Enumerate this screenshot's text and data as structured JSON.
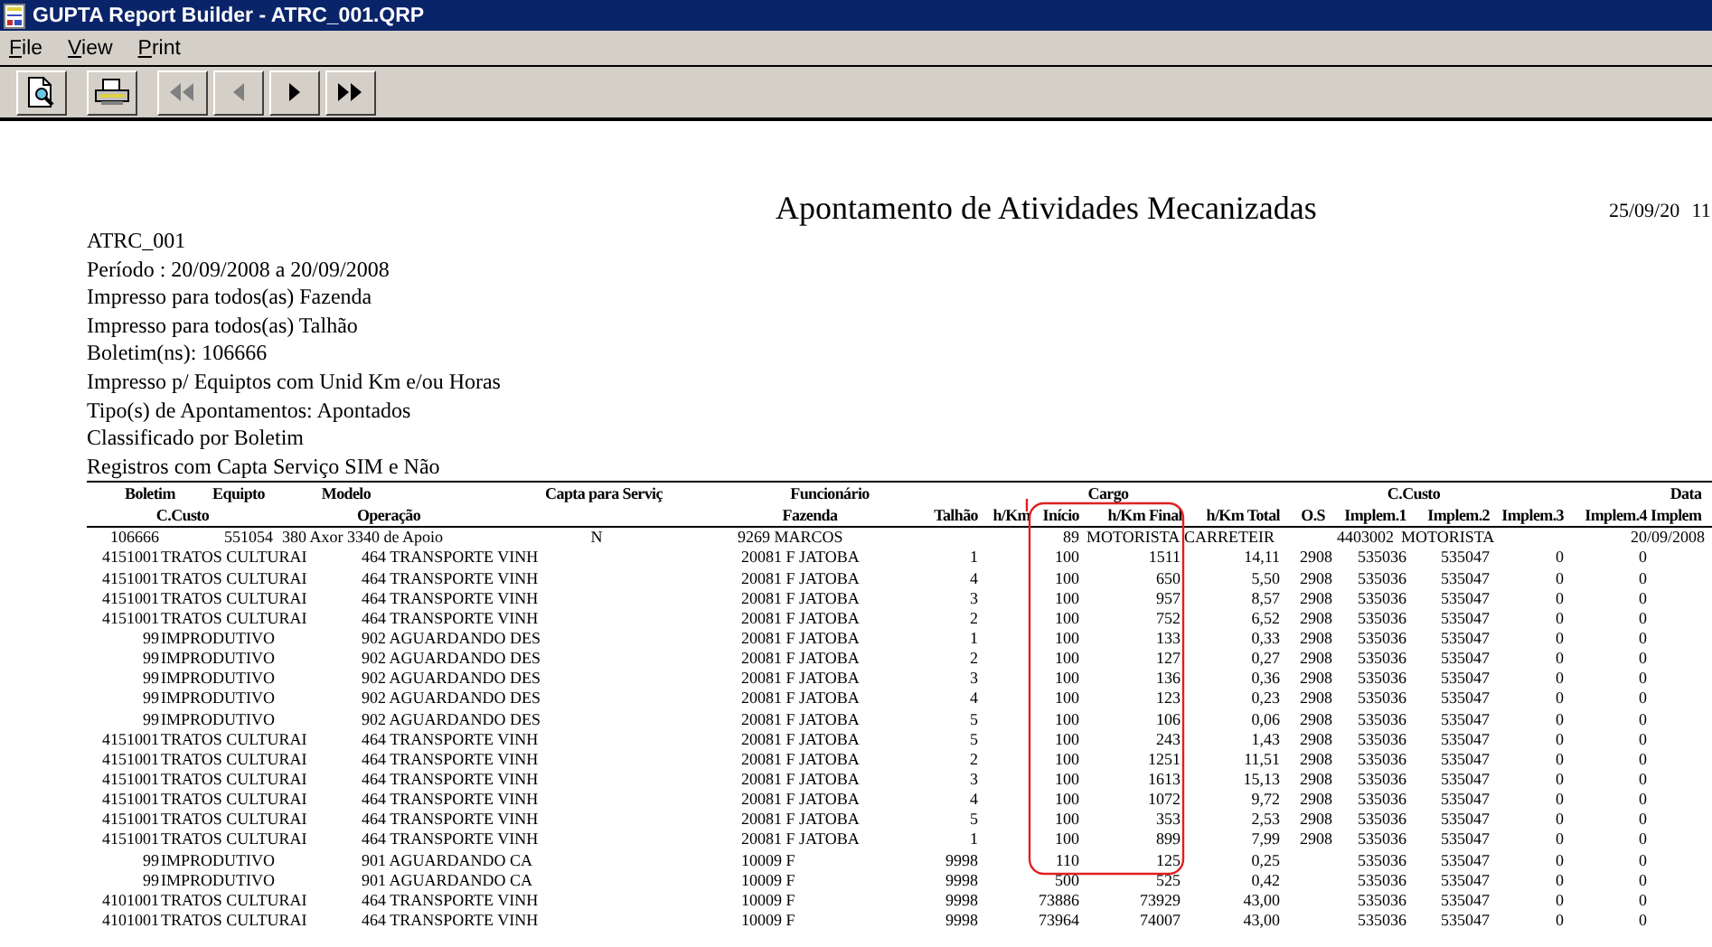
{
  "window": {
    "title": "GUPTA Report Builder - ATRC_001.QRP"
  },
  "menu": [
    {
      "label": "File"
    },
    {
      "label": "View"
    },
    {
      "label": "Print"
    }
  ],
  "toolbar": [
    {
      "kind": "preview",
      "disabled": false
    },
    {
      "kind": "print",
      "disabled": false
    },
    {
      "kind": "first",
      "disabled": true
    },
    {
      "kind": "previous",
      "disabled": true
    },
    {
      "kind": "next",
      "disabled": false
    },
    {
      "kind": "last",
      "disabled": false
    }
  ],
  "report": {
    "title": "Apontamento de Atividades Mecanizadas",
    "date": "25/09/20",
    "time": "11",
    "info": [
      "ATRC_001",
      "Período : 20/09/2008 a 20/09/2008",
      "Impresso para todos(as) Fazenda",
      "Impresso para todos(as) Talhão",
      "Boletim(ns): 106666",
      "Impresso p/ Equiptos com Unid Km e/ou Horas",
      "Tipo(s) de Apontamentos: Apontados",
      "Classificado por Boletim",
      "Registros com Capta Serviço SIM e Não"
    ],
    "table": {
      "header_1": [
        "Boletim",
        "Equipto",
        "Modelo",
        "Capta para Serviç",
        "Funcionário",
        "Cargo",
        "C.Custo",
        "Data"
      ],
      "header_2": [
        "C.Custo",
        "Operação",
        "Fazenda",
        "Talhão",
        "h/Km",
        "Início",
        "h/Km Final",
        "h/Km Total",
        "O.S",
        "Implem.1",
        "Implem.2",
        "Implem.3",
        "Implem.4",
        "Implem"
      ],
      "group": {
        "boletim": "106666",
        "equipto": "551054",
        "modelo": "380 Axor 3340 de Apoio",
        "capta": "N",
        "funcionario": "9269 MARCOS",
        "cargo_code": "89",
        "cargo": "MOTORISTA",
        "column_8": "CARRETEIR",
        "c_custo_code": "4403002",
        "c_custo": "MOTORISTA",
        "data": "20/09/2008"
      },
      "rows": [
        {
          "c_custo": "4151001",
          "c_custo_name": "TRATOS CULTURAI",
          "operacao": "464 TRANSPORTE VINH",
          "fazenda": "20081 F JATOBA",
          "talhao": "1",
          "inicio": "100",
          "final": "1511",
          "total": "14,11",
          "os": "2908",
          "implem_1": "535036",
          "implem_2": "535047",
          "implem_3": "0",
          "implem_4": "0"
        },
        {
          "c_custo": "4151001",
          "c_custo_name": "TRATOS CULTURAI",
          "operacao": "464 TRANSPORTE VINH",
          "fazenda": "20081 F JATOBA",
          "talhao": "4",
          "inicio": "100",
          "final": "650",
          "total": "5,50",
          "os": "2908",
          "implem_1": "535036",
          "implem_2": "535047",
          "implem_3": "0",
          "implem_4": "0"
        },
        {
          "c_custo": "4151001",
          "c_custo_name": "TRATOS CULTURAI",
          "operacao": "464 TRANSPORTE VINH",
          "fazenda": "20081 F JATOBA",
          "talhao": "3",
          "inicio": "100",
          "final": "957",
          "total": "8,57",
          "os": "2908",
          "implem_1": "535036",
          "implem_2": "535047",
          "implem_3": "0",
          "implem_4": "0"
        },
        {
          "c_custo": "4151001",
          "c_custo_name": "TRATOS CULTURAI",
          "operacao": "464 TRANSPORTE VINH",
          "fazenda": "20081 F JATOBA",
          "talhao": "2",
          "inicio": "100",
          "final": "752",
          "total": "6,52",
          "os": "2908",
          "implem_1": "535036",
          "implem_2": "535047",
          "implem_3": "0",
          "implem_4": "0"
        },
        {
          "c_custo": "99",
          "c_custo_name": "IMPRODUTIVO",
          "operacao": "902 AGUARDANDO DES",
          "fazenda": "20081 F JATOBA",
          "talhao": "1",
          "inicio": "100",
          "final": "133",
          "total": "0,33",
          "os": "2908",
          "implem_1": "535036",
          "implem_2": "535047",
          "implem_3": "0",
          "implem_4": "0"
        },
        {
          "c_custo": "99",
          "c_custo_name": "IMPRODUTIVO",
          "operacao": "902 AGUARDANDO DES",
          "fazenda": "20081 F JATOBA",
          "talhao": "2",
          "inicio": "100",
          "final": "127",
          "total": "0,27",
          "os": "2908",
          "implem_1": "535036",
          "implem_2": "535047",
          "implem_3": "0",
          "implem_4": "0"
        },
        {
          "c_custo": "99",
          "c_custo_name": "IMPRODUTIVO",
          "operacao": "902 AGUARDANDO DES",
          "fazenda": "20081 F JATOBA",
          "talhao": "3",
          "inicio": "100",
          "final": "136",
          "total": "0,36",
          "os": "2908",
          "implem_1": "535036",
          "implem_2": "535047",
          "implem_3": "0",
          "implem_4": "0"
        },
        {
          "c_custo": "99",
          "c_custo_name": "IMPRODUTIVO",
          "operacao": "902 AGUARDANDO DES",
          "fazenda": "20081 F JATOBA",
          "talhao": "4",
          "inicio": "100",
          "final": "123",
          "total": "0,23",
          "os": "2908",
          "implem_1": "535036",
          "implem_2": "535047",
          "implem_3": "0",
          "implem_4": "0"
        },
        {
          "c_custo": "99",
          "c_custo_name": "IMPRODUTIVO",
          "operacao": "902 AGUARDANDO DES",
          "fazenda": "20081 F JATOBA",
          "talhao": "5",
          "inicio": "100",
          "final": "106",
          "total": "0,06",
          "os": "2908",
          "implem_1": "535036",
          "implem_2": "535047",
          "implem_3": "0",
          "implem_4": "0"
        },
        {
          "c_custo": "4151001",
          "c_custo_name": "TRATOS CULTURAI",
          "operacao": "464 TRANSPORTE VINH",
          "fazenda": "20081 F JATOBA",
          "talhao": "5",
          "inicio": "100",
          "final": "243",
          "total": "1,43",
          "os": "2908",
          "implem_1": "535036",
          "implem_2": "535047",
          "implem_3": "0",
          "implem_4": "0"
        },
        {
          "c_custo": "4151001",
          "c_custo_name": "TRATOS CULTURAI",
          "operacao": "464 TRANSPORTE VINH",
          "fazenda": "20081 F JATOBA",
          "talhao": "2",
          "inicio": "100",
          "final": "1251",
          "total": "11,51",
          "os": "2908",
          "implem_1": "535036",
          "implem_2": "535047",
          "implem_3": "0",
          "implem_4": "0"
        },
        {
          "c_custo": "4151001",
          "c_custo_name": "TRATOS CULTURAI",
          "operacao": "464 TRANSPORTE VINH",
          "fazenda": "20081 F JATOBA",
          "talhao": "3",
          "inicio": "100",
          "final": "1613",
          "total": "15,13",
          "os": "2908",
          "implem_1": "535036",
          "implem_2": "535047",
          "implem_3": "0",
          "implem_4": "0"
        },
        {
          "c_custo": "4151001",
          "c_custo_name": "TRATOS CULTURAI",
          "operacao": "464 TRANSPORTE VINH",
          "fazenda": "20081 F JATOBA",
          "talhao": "4",
          "inicio": "100",
          "final": "1072",
          "total": "9,72",
          "os": "2908",
          "implem_1": "535036",
          "implem_2": "535047",
          "implem_3": "0",
          "implem_4": "0"
        },
        {
          "c_custo": "4151001",
          "c_custo_name": "TRATOS CULTURAI",
          "operacao": "464 TRANSPORTE VINH",
          "fazenda": "20081 F JATOBA",
          "talhao": "5",
          "inicio": "100",
          "final": "353",
          "total": "2,53",
          "os": "2908",
          "implem_1": "535036",
          "implem_2": "535047",
          "implem_3": "0",
          "implem_4": "0"
        },
        {
          "c_custo": "4151001",
          "c_custo_name": "TRATOS CULTURAI",
          "operacao": "464 TRANSPORTE VINH",
          "fazenda": "20081 F JATOBA",
          "talhao": "1",
          "inicio": "100",
          "final": "899",
          "total": "7,99",
          "os": "2908",
          "implem_1": "535036",
          "implem_2": "535047",
          "implem_3": "0",
          "implem_4": "0"
        },
        {
          "c_custo": "99",
          "c_custo_name": "IMPRODUTIVO",
          "operacao": "901 AGUARDANDO CA",
          "fazenda": "10009 F",
          "talhao": "9998",
          "inicio": "110",
          "final": "125",
          "total": "0,25",
          "implem_1": "535036",
          "implem_2": "535047",
          "implem_3": "0",
          "implem_4": "0"
        },
        {
          "c_custo": "99",
          "c_custo_name": "IMPRODUTIVO",
          "operacao": "901 AGUARDANDO CA",
          "fazenda": "10009 F",
          "talhao": "9998",
          "inicio": "500",
          "final": "525",
          "total": "0,42",
          "implem_1": "535036",
          "implem_2": "535047",
          "implem_3": "0",
          "implem_4": "0"
        },
        {
          "c_custo": "4101001",
          "c_custo_name": "TRATOS CULTURAI",
          "operacao": "464 TRANSPORTE VINH",
          "fazenda": "10009 F",
          "talhao": "9998",
          "inicio": "73886",
          "final": "73929",
          "total": "43,00",
          "implem_1": "535036",
          "implem_2": "535047",
          "implem_3": "0",
          "implem_4": "0"
        },
        {
          "c_custo": "4101001",
          "c_custo_name": "TRATOS CULTURAI",
          "operacao": "464 TRANSPORTE VINH",
          "fazenda": "10009 F",
          "talhao": "9998",
          "inicio": "73964",
          "final": "74007",
          "total": "43,00",
          "implem_1": "535036",
          "implem_2": "535047",
          "implem_3": "0",
          "implem_4": "0"
        }
      ]
    }
  }
}
